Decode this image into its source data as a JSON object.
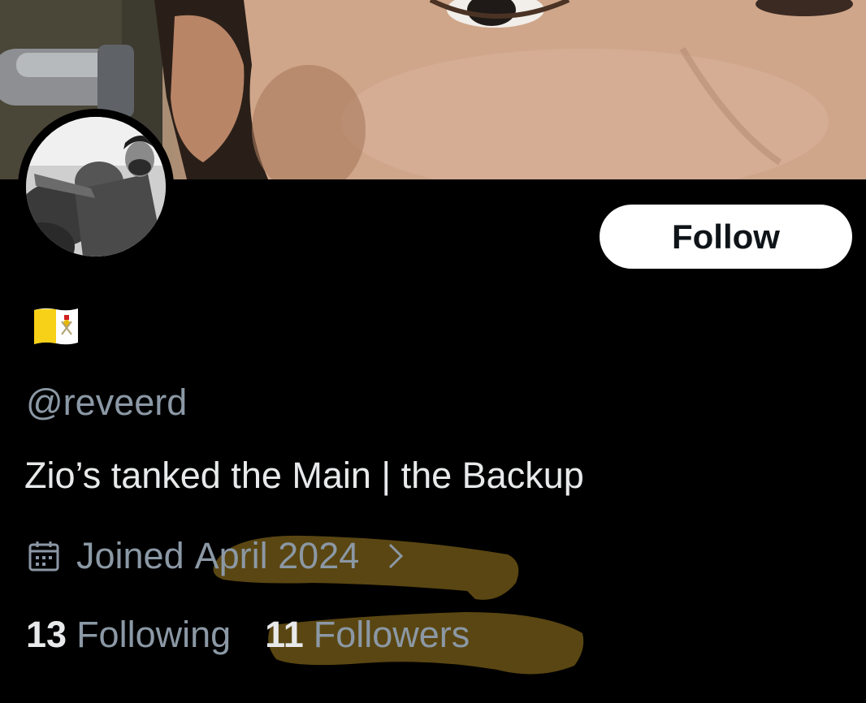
{
  "profile": {
    "flag_emoji_name": "vatican-flag",
    "handle": "@reveerd",
    "bio": "Zio’s tanked the Main | the Backup",
    "joined_prefix": "Joined",
    "joined_date": "April 2024",
    "following_count": "13",
    "following_label": "Following",
    "followers_count": "11",
    "followers_label": "Followers"
  },
  "actions": {
    "follow_label": "Follow"
  },
  "colors": {
    "background": "#000000",
    "primary_text": "#e7e9ea",
    "secondary_text": "#8b98a5",
    "marker_highlight": "#5a4612",
    "follow_button_bg": "#ffffff"
  }
}
